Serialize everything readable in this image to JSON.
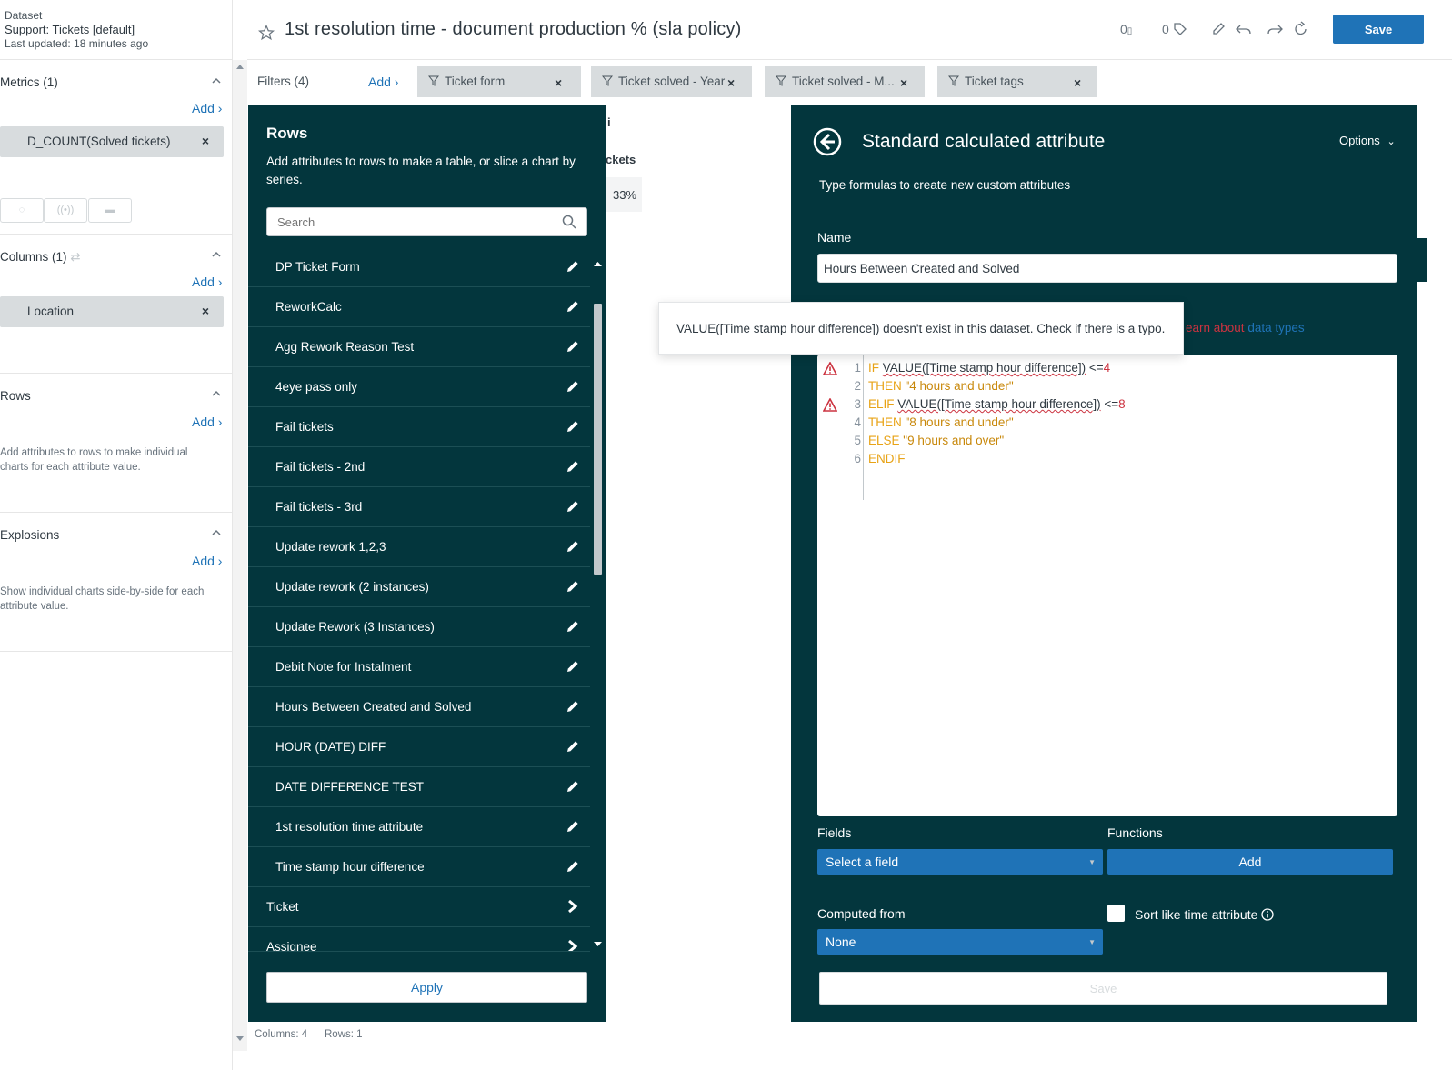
{
  "dataset": {
    "label": "Dataset",
    "name": "Support: Tickets [default]",
    "updated": "Last updated: 18 minutes ago"
  },
  "sidebar": {
    "metrics": {
      "title": "Metrics (1)",
      "add": "Add",
      "pill": "D_COUNT(Solved tickets)"
    },
    "columns": {
      "title": "Columns (1)",
      "add": "Add",
      "pill": "Location"
    },
    "rows": {
      "title": "Rows",
      "add": "Add",
      "desc": "Add attributes to rows to make individual charts for each attribute value."
    },
    "explosions": {
      "title": "Explosions",
      "add": "Add",
      "desc": "Show individual charts side-by-side for each attribute value."
    }
  },
  "header": {
    "title": "1st resolution time - document production % (sla policy)",
    "comment_count": "0",
    "tag_count": "0",
    "save_label": "Save"
  },
  "filters": {
    "label": "Filters (4)",
    "add": "Add",
    "chips": [
      "Ticket form",
      "Ticket solved - Year",
      "Ticket solved - M...",
      "Ticket tags"
    ]
  },
  "rows_panel": {
    "title": "Rows",
    "description": "Add attributes to rows to make a table, or slice a chart by series.",
    "search_placeholder": "Search",
    "items": [
      "DP Ticket Form",
      "ReworkCalc",
      "Agg Rework Reason Test",
      "4eye pass only",
      "Fail tickets",
      "Fail tickets - 2nd",
      "Fail tickets - 3rd",
      "Update rework 1,2,3",
      "Update rework (2 instances)",
      "Update Rework (3 Instances)",
      "Debit Note for Instalment",
      "Hours Between Created and Solved",
      "HOUR (DATE) DIFF",
      "DATE DIFFERENCE TEST",
      "1st resolution time attribute",
      "Time stamp hour difference"
    ],
    "groups": [
      "Ticket",
      "Assignee"
    ],
    "apply_label": "Apply"
  },
  "mid_fragment": {
    "heading_i": "i",
    "heading": "ckets",
    "value": "33%"
  },
  "calc": {
    "title": "Standard calculated attribute",
    "subtitle": "Type formulas to create new custom attributes",
    "options": "Options",
    "name_label": "Name",
    "name_value": "Hours Between Created and Solved",
    "learn_prefix": "earn about",
    "learn_link": "data types",
    "fields_label": "Fields",
    "fields_select": "Select a field",
    "functions_label": "Functions",
    "functions_add": "Add",
    "computed_label": "Computed from",
    "computed_select": "None",
    "sort_label": "Sort like time attribute",
    "save_label": "Save",
    "code": {
      "l1": {
        "n": "1",
        "kw": "IF ",
        "fn": "VALUE([Time stamp hour difference])",
        "op": " <=",
        "num": "4"
      },
      "l2": {
        "n": "2",
        "kw": "THEN ",
        "str": "\"4 hours and under\""
      },
      "l3": {
        "n": "3",
        "kw": "ELIF ",
        "fn": "VALUE([Time stamp hour difference])",
        "op": " <=",
        "num": "8"
      },
      "l4": {
        "n": "4",
        "kw": "THEN ",
        "str": "\"8 hours and under\""
      },
      "l5": {
        "n": "5",
        "kw": "ELSE ",
        "str": "\"9 hours and over\""
      },
      "l6": {
        "n": "6",
        "kw": "ENDIF"
      }
    }
  },
  "tooltip": "VALUE([Time stamp hour difference]) doesn't exist in this dataset. Check if there is a typo.",
  "footer": {
    "columns": "Columns: 4",
    "rows": "Rows: 1"
  },
  "colors": {
    "panel": "#03363d",
    "accent": "#1f73b7",
    "error": "#cc3340",
    "keyword": "#e8a316"
  }
}
